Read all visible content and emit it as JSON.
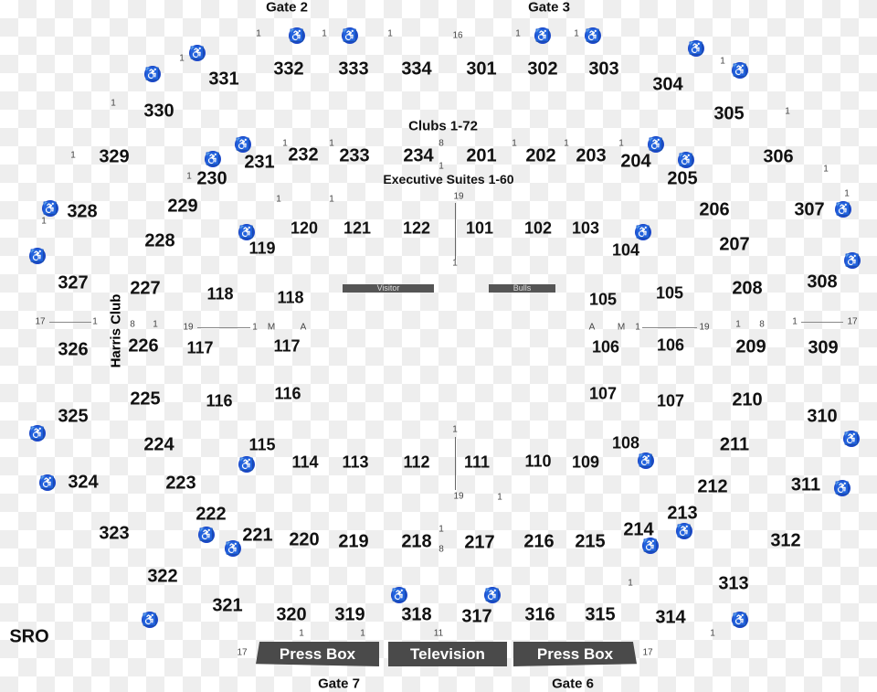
{
  "gates": [
    "Gate 2",
    "Gate 3",
    "Gate 7",
    "Gate 6"
  ],
  "areas": {
    "clubs": "Clubs 1-72",
    "suites": "Executive Suites 1-60",
    "harris_club": "Harris Club",
    "sro": "SRO",
    "visitor": "Visitor",
    "bulls": "Bulls",
    "press_box_left": "Press Box",
    "television": "Television",
    "press_box_right": "Press Box"
  },
  "sections": [
    "331",
    "332",
    "333",
    "334",
    "301",
    "302",
    "303",
    "304",
    "305",
    "306",
    "307",
    "308",
    "309",
    "310",
    "311",
    "312",
    "313",
    "314",
    "315",
    "316",
    "317",
    "318",
    "319",
    "320",
    "321",
    "322",
    "323",
    "324",
    "325",
    "326",
    "327",
    "328",
    "329",
    "330",
    "230",
    "231",
    "232",
    "233",
    "234",
    "201",
    "202",
    "203",
    "204",
    "205",
    "206",
    "207",
    "208",
    "209",
    "210",
    "211",
    "212",
    "213",
    "214",
    "215",
    "216",
    "217",
    "218",
    "219",
    "220",
    "221",
    "222",
    "223",
    "224",
    "225",
    "226",
    "227",
    "228",
    "229",
    "120",
    "121",
    "122",
    "101",
    "102",
    "103",
    "104",
    "105",
    "105",
    "106",
    "106",
    "107",
    "107",
    "108",
    "109",
    "110",
    "111",
    "112",
    "113",
    "114",
    "115",
    "116",
    "116",
    "117",
    "117",
    "118",
    "118",
    "119"
  ],
  "row_markers": [
    "1",
    "1",
    "1",
    "1",
    "1",
    "1",
    "1",
    "1",
    "1",
    "1",
    "1",
    "1",
    "1",
    "1",
    "1",
    "1",
    "1",
    "1",
    "1",
    "1",
    "1",
    "16",
    "8",
    "1",
    "19",
    "1",
    "17",
    "1",
    "8",
    "1",
    "19",
    "1",
    "M",
    "A",
    "A",
    "M",
    "1",
    "19",
    "1",
    "8",
    "1",
    "17",
    "19",
    "1",
    "1",
    "8",
    "11",
    "17",
    "17",
    "1",
    "1",
    "1",
    "1",
    "1"
  ],
  "accessibility_icon": "wheelchair-icon",
  "colors": {
    "accessible": "#1a47c8",
    "press_box": "#4a4a4a"
  }
}
